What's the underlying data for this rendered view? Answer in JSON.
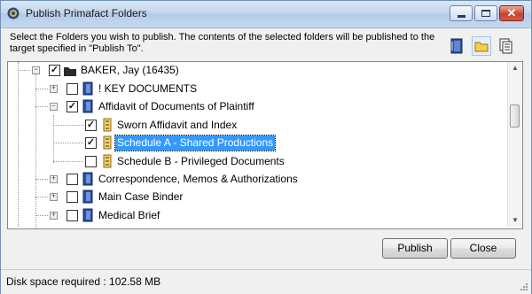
{
  "window": {
    "title": "Publish Primafact Folders"
  },
  "instructions": "Select the Folders you wish to publish.  The contents of the selected folders will be published to the target specified in \"Publish To\".",
  "toolbar": {
    "icons": [
      "binder-icon",
      "folder-icon",
      "documents-icon"
    ]
  },
  "tree": {
    "root": {
      "label": "BAKER, Jay (16435)",
      "checked": true,
      "expanded": true
    },
    "items": [
      {
        "label": "! KEY DOCUMENTS",
        "checked": false,
        "expanded": false,
        "icon": "binder-icon"
      },
      {
        "label": "Affidavit of Documents of Plaintiff",
        "checked": true,
        "expanded": true,
        "icon": "binder-icon",
        "children": [
          {
            "label": "Sworn Affidavit and Index",
            "checked": true,
            "selected": false,
            "icon": "tab-icon"
          },
          {
            "label": "Schedule A - Shared Productions",
            "checked": true,
            "selected": true,
            "icon": "tab-icon"
          },
          {
            "label": "Schedule B - Privileged Documents",
            "checked": false,
            "selected": false,
            "icon": "tab-icon"
          }
        ]
      },
      {
        "label": "Correspondence, Memos & Authorizations",
        "checked": false,
        "expanded": false,
        "icon": "binder-icon"
      },
      {
        "label": "Main Case Binder",
        "checked": false,
        "expanded": false,
        "icon": "binder-icon"
      },
      {
        "label": "Medical Brief",
        "checked": false,
        "expanded": false,
        "icon": "binder-icon"
      }
    ]
  },
  "buttons": {
    "publish": "Publish",
    "close": "Close"
  },
  "status": {
    "disk_space": "Disk space required : 102.58 MB"
  },
  "colors": {
    "selection": "#3399ff",
    "binder": "#2a4f9e",
    "tab": "#d9a21b"
  }
}
